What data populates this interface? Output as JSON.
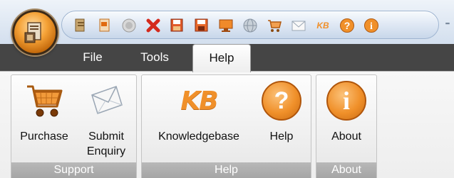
{
  "quick_access": {
    "icons": [
      "document-icon",
      "page-icon",
      "stop-icon",
      "delete-icon",
      "save-icon",
      "save-as-icon",
      "monitor-icon",
      "globe-icon",
      "cart-icon",
      "mail-icon",
      "kb-icon",
      "help-icon",
      "info-icon"
    ],
    "kb_text": "KB",
    "more_glyph": "⁼"
  },
  "tabs": {
    "file": "File",
    "tools": "Tools",
    "help": "Help",
    "active": "Help"
  },
  "groups": {
    "support": {
      "title": "Support",
      "purchase_label": "Purchase",
      "enquiry_label": "Submit Enquiry"
    },
    "help": {
      "title": "Help",
      "kb_label": "Knowledgebase",
      "kb_logo": "KB",
      "help_label": "Help",
      "help_glyph": "?"
    },
    "about": {
      "title": "About",
      "about_label": "About",
      "about_glyph": "i"
    }
  },
  "colors": {
    "accent_orange": "#f0902a",
    "tab_bar": "#454545",
    "group_title_bar": "#a8a8a8"
  }
}
